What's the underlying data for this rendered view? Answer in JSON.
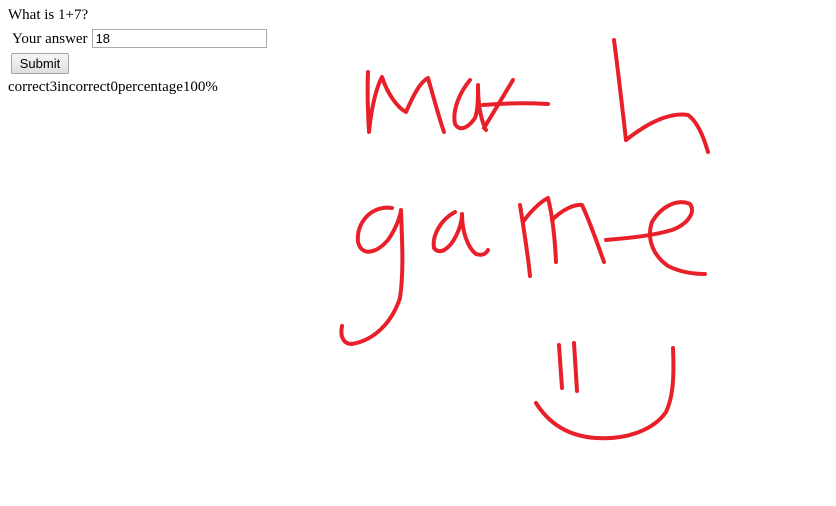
{
  "quiz": {
    "question": "What is 1+7?",
    "answer_label": "Your answer",
    "answer_value": "18",
    "submit_label": "Submit"
  },
  "stats": {
    "correct_label": "correct",
    "correct_count": "3",
    "incorrect_label": "incorrect",
    "incorrect_count": "0",
    "percentage_label": "percentage",
    "percentage_value": "100%"
  },
  "drawing": {
    "text": "math game",
    "ink_color": "#e8202a"
  }
}
